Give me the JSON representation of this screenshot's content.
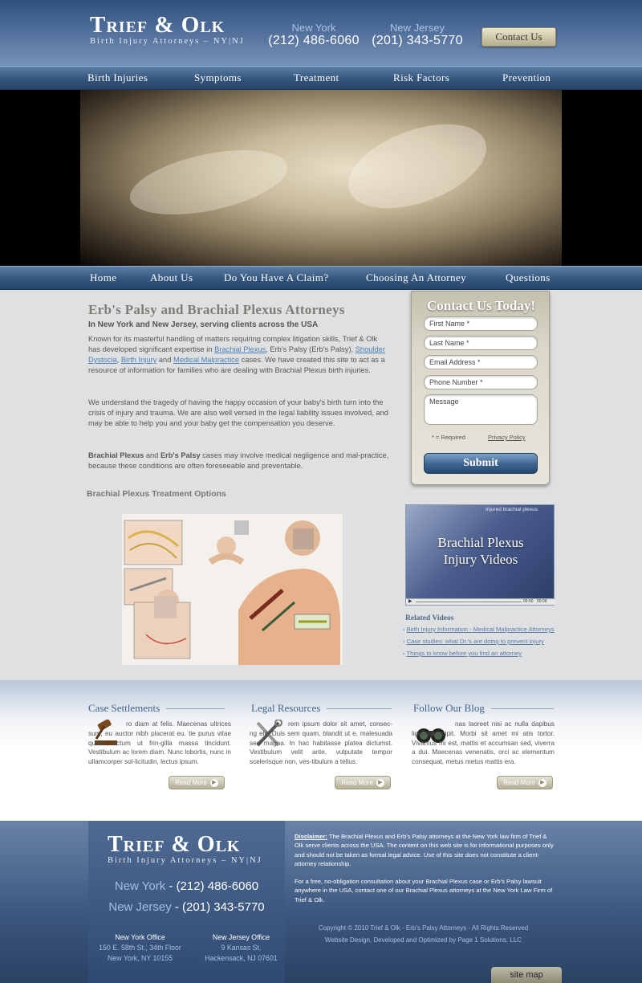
{
  "brand": {
    "name": "Trief & Olk",
    "tagline": "Birth Injury Attorneys – NY|NJ"
  },
  "header": {
    "phones": [
      {
        "city": "New York",
        "number": "(212) 486-6060"
      },
      {
        "city": "New Jersey",
        "number": "(201) 343-5770"
      }
    ],
    "contact_button": "Contact Us"
  },
  "nav_top": [
    "Birth Injuries",
    "Symptoms",
    "Treatment",
    "Risk Factors",
    "Prevention"
  ],
  "nav_bottom": [
    "Home",
    "About Us",
    "Do You Have A Claim?",
    "Choosing An Attorney",
    "Questions"
  ],
  "main": {
    "title": "Erb's Palsy and Brachial Plexus Attorneys",
    "subtitle": "In New York and New Jersey, serving clients across the USA",
    "p1_a": "Known for its masterful handling of matters requiring complex litigation skills, Trief & Olk has developed significant expertise in ",
    "p1_link1": "Brachial Plexus",
    "p1_b": ", Erb's Palsy (Erb's Palsy), ",
    "p1_link2": "Shoulder Dystocia",
    "p1_c": ", ",
    "p1_link3": "Birth Injury",
    "p1_d": " and ",
    "p1_link4": "Medical Malpractice",
    "p1_e": " cases. We have created this site to act as a resource of information for families who are dealing with Brachial Plexus birth injuries.",
    "p2": "We understand the tragedy of having the happy occasion of your baby's birth turn into the crisis of injury and trauma. We are also well versed in the legal liability issues involved, and may be able to help you and your baby get the compensation you deserve.",
    "p3_b1": "Brachial Plexus",
    "p3_and": " and ",
    "p3_b2": "Erb's Palsy",
    "p3_rest": " cases may involve medical negligence and mal-practice, because these conditions are often foreseeable and preventable.",
    "treatment_title": "Brachial Plexus Treatment Options"
  },
  "form": {
    "title": "Contact Us Today!",
    "first_name": "First Name *",
    "last_name": "Last Name *",
    "email": "Email Address *",
    "phone": "Phone Number *",
    "message": "Message",
    "required": "* = Required",
    "privacy": "Privacy Policy",
    "submit": "Submit"
  },
  "video": {
    "overlay_tag": "Injured brachial plexus",
    "title_line1": "Brachial Plexus",
    "title_line2": "Injury Videos",
    "time_left": "00:00",
    "time_right": "00:00"
  },
  "related_videos": {
    "title": "Related Videos",
    "items": [
      "Birth Injury Information - Medical Malpractice Attorneys",
      "Case studies: what Dr.'s  are doing to prevent injury",
      "Things to know before you find an attorney"
    ]
  },
  "columns": [
    {
      "title": "Case Settlements",
      "text": "ro diam at felis. Maecenas ultrices sum, eu auctor nibh placerat eu. tie purus vitae quam dictum ut frin-gilla massa tincidunt. Vestibulum ac lorem diam. Nunc lobortis, nunc in ullamcorper sol-licitudin, lectus ipsum.",
      "icon": "gavel-icon",
      "read_more": "Read More"
    },
    {
      "title": "Legal Resources",
      "text": "rem ipsum dolor sit amet, consec-ng elit. Duis sem quam, blandit ut e, malesuada sed magna. In hac habitasse platea dictumst. Vestibulum velit ante, vulputate tempor scelerisque non, ves-tibulum a tellus.",
      "icon": "tools-icon",
      "read_more": "Read More"
    },
    {
      "title": "Follow Our Blog",
      "text": "nas laoreet nisi ac nulla dapibus ligula suscipit. Morbi sit amet mi atis tortor. Vivamus mi est, mattis et accumsan sed, viverra a dui. Maecenas venenatis, orci ac elementum consequat, metus metus mattis era.",
      "icon": "binoculars-icon",
      "read_more": "Read More"
    }
  ],
  "footer": {
    "phones": [
      {
        "city": "New York",
        "number": " - (212) 486-6060"
      },
      {
        "city": "New Jersey",
        "number": " - (201) 343-5770"
      }
    ],
    "offices": [
      {
        "name": "New York Office",
        "line1": "150 E. 58th St., 34th Floor",
        "line2": "New York, NY 10155"
      },
      {
        "name": "New Jersey Office",
        "line1": "9 Kansas St.",
        "line2": "Hackensack, NJ  07601"
      }
    ],
    "disclaimer_label": "Disclaimer:",
    "disclaimer_text": " The Brachial Plexus and Erb's Palsy attorneys at the New York law firm of Trief & Olk serve clients across the USA. The content on this web site is for informational purposes only and should not be taken as formal legal advice. Use of this site does not constitute a client-attorney relationship.",
    "consult": "For a free, no-obligation consultation about your Brachial Plexus case or Erb's Palsy lawsuit anywhere in the USA, contact one of our Brachial Plexus attorneys at the New York Law Firm of Trief & Olk.",
    "copyright": "Copyright © 2010 Trief & Olk - Erb's Palsy Attorneys - All Rights Reserved",
    "credit": "Website Design, Developed and Optimized by Page 1 Solutions, LLC",
    "sitemap": "site map"
  }
}
